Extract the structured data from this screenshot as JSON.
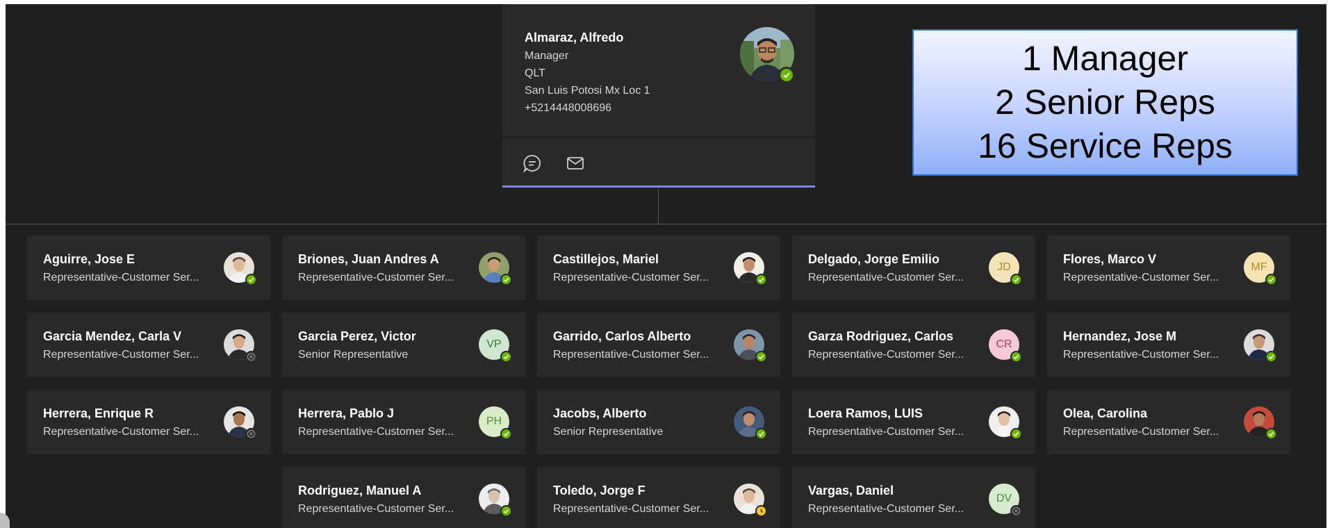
{
  "manager": {
    "name": "Almaraz, Alfredo",
    "title": "Manager",
    "department": "QLT",
    "location": "San Luis Potosi Mx Loc 1",
    "phone": "+5214448008696",
    "status": "available",
    "actions": [
      {
        "icon": "chat-icon"
      },
      {
        "icon": "mail-icon"
      }
    ]
  },
  "summary": {
    "lines": [
      "1 Manager",
      "2 Senior Reps",
      "16 Service Reps"
    ]
  },
  "reports": [
    {
      "name": "Aguirre, Jose E",
      "title": "Representative-Customer Ser...",
      "avatar": "photo",
      "status": "available"
    },
    {
      "name": "Briones, Juan Andres A",
      "title": "Representative-Customer Ser...",
      "avatar": "photo",
      "status": "available"
    },
    {
      "name": "Castillejos, Mariel",
      "title": "Representative-Customer Ser...",
      "avatar": "photo",
      "status": "available"
    },
    {
      "name": "Delgado, Jorge Emilio",
      "title": "Representative-Customer Ser...",
      "avatar": "initials",
      "initials": "JD",
      "status": "available"
    },
    {
      "name": "Flores, Marco V",
      "title": "Representative-Customer Ser...",
      "avatar": "initials",
      "initials": "MF",
      "status": "available"
    },
    {
      "name": "Garcia Mendez, Carla V",
      "title": "Representative-Customer Ser...",
      "avatar": "photo",
      "status": "offline"
    },
    {
      "name": "Garcia Perez, Victor",
      "title": "Senior Representative",
      "avatar": "initials",
      "initials": "VP",
      "status": "available"
    },
    {
      "name": "Garrido, Carlos Alberto",
      "title": "Representative-Customer Ser...",
      "avatar": "photo",
      "status": "available"
    },
    {
      "name": "Garza Rodriguez, Carlos",
      "title": "Representative-Customer Ser...",
      "avatar": "initials",
      "initials": "CR",
      "status": "available"
    },
    {
      "name": "Hernandez, Jose M",
      "title": "Representative-Customer Ser...",
      "avatar": "photo",
      "status": "available"
    },
    {
      "name": "Herrera, Enrique R",
      "title": "Representative-Customer Ser...",
      "avatar": "photo",
      "status": "offline"
    },
    {
      "name": "Herrera, Pablo J",
      "title": "Representative-Customer Ser...",
      "avatar": "initials",
      "initials": "PH",
      "status": "available"
    },
    {
      "name": "Jacobs, Alberto",
      "title": "Senior Representative",
      "avatar": "photo",
      "status": "available"
    },
    {
      "name": "Loera Ramos, LUIS",
      "title": "Representative-Customer Ser...",
      "avatar": "photo",
      "status": "available"
    },
    {
      "name": "Olea, Carolina",
      "title": "Representative-Customer Ser...",
      "avatar": "photo",
      "status": "available"
    },
    {
      "name": "Rodriguez, Manuel A",
      "title": "Representative-Customer Ser...",
      "avatar": "photo",
      "status": "available"
    },
    {
      "name": "Toledo, Jorge F",
      "title": "Representative-Customer Ser...",
      "avatar": "photo",
      "status": "away"
    },
    {
      "name": "Vargas, Daniel",
      "title": "Representative-Customer Ser...",
      "avatar": "initials",
      "initials": "DV",
      "status": "offline"
    }
  ],
  "colors": {
    "background": "#1f1f1f",
    "card": "#292929",
    "accent": "#7f85f5",
    "available": "#6bb700",
    "away": "#f8c630",
    "offline": "#8a8a8a",
    "initials_palette": {
      "JD": {
        "bg": "#f5e3b8",
        "fg": "#b38a2e"
      },
      "MF": {
        "bg": "#f7e3b2",
        "fg": "#b28828"
      },
      "VP": {
        "bg": "#cfe6cf",
        "fg": "#3e7a46"
      },
      "CR": {
        "bg": "#f6c9d8",
        "fg": "#b03a64"
      },
      "PH": {
        "bg": "#d9ecc8",
        "fg": "#5b8a3a"
      },
      "DV": {
        "bg": "#d7eccf",
        "fg": "#4f8a45"
      }
    }
  }
}
